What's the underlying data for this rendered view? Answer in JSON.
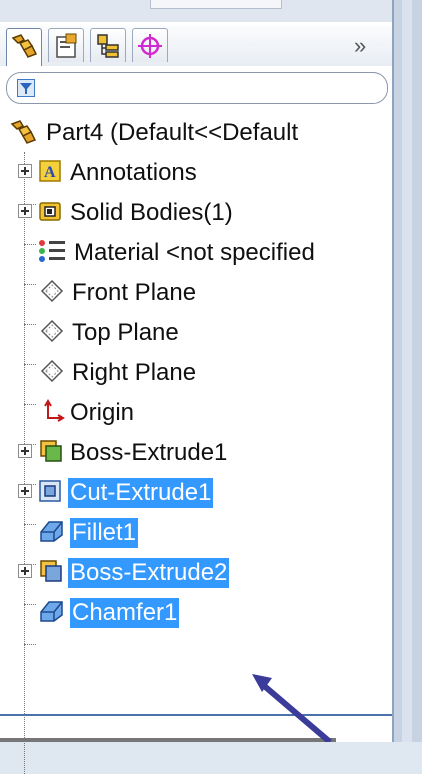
{
  "tree": {
    "root": "Part4  (Default<<Default",
    "items": [
      {
        "label": "Annotations",
        "icon": "annotations-icon"
      },
      {
        "label": "Solid Bodies(1)",
        "icon": "solid-bodies-icon"
      },
      {
        "label": "Material <not specified",
        "icon": "material-icon"
      },
      {
        "label": "Front Plane",
        "icon": "plane-icon"
      },
      {
        "label": "Top Plane",
        "icon": "plane-icon"
      },
      {
        "label": "Right Plane",
        "icon": "plane-icon"
      },
      {
        "label": "Origin",
        "icon": "origin-icon"
      },
      {
        "label": "Boss-Extrude1",
        "icon": "boss-extrude-icon"
      },
      {
        "label": "Cut-Extrude1",
        "icon": "cut-extrude-icon",
        "selected": true
      },
      {
        "label": "Fillet1",
        "icon": "fillet-icon",
        "selected": true
      },
      {
        "label": "Boss-Extrude2",
        "icon": "boss-extrude-icon",
        "selected": true
      },
      {
        "label": "Chamfer1",
        "icon": "chamfer-icon",
        "selected": true
      }
    ]
  },
  "tabs": {
    "more": "»",
    "items": [
      {
        "name": "feature-manager-tab",
        "icon": "feature-tree-icon"
      },
      {
        "name": "property-manager-tab",
        "icon": "property-manager-icon"
      },
      {
        "name": "configuration-manager-tab",
        "icon": "configuration-icon"
      },
      {
        "name": "dimxpert-tab",
        "icon": "crosshair-icon"
      }
    ]
  },
  "colors": {
    "selection": "#3399ff",
    "arrow": "#3b3b9a",
    "accent_line": "#4a72a8"
  }
}
